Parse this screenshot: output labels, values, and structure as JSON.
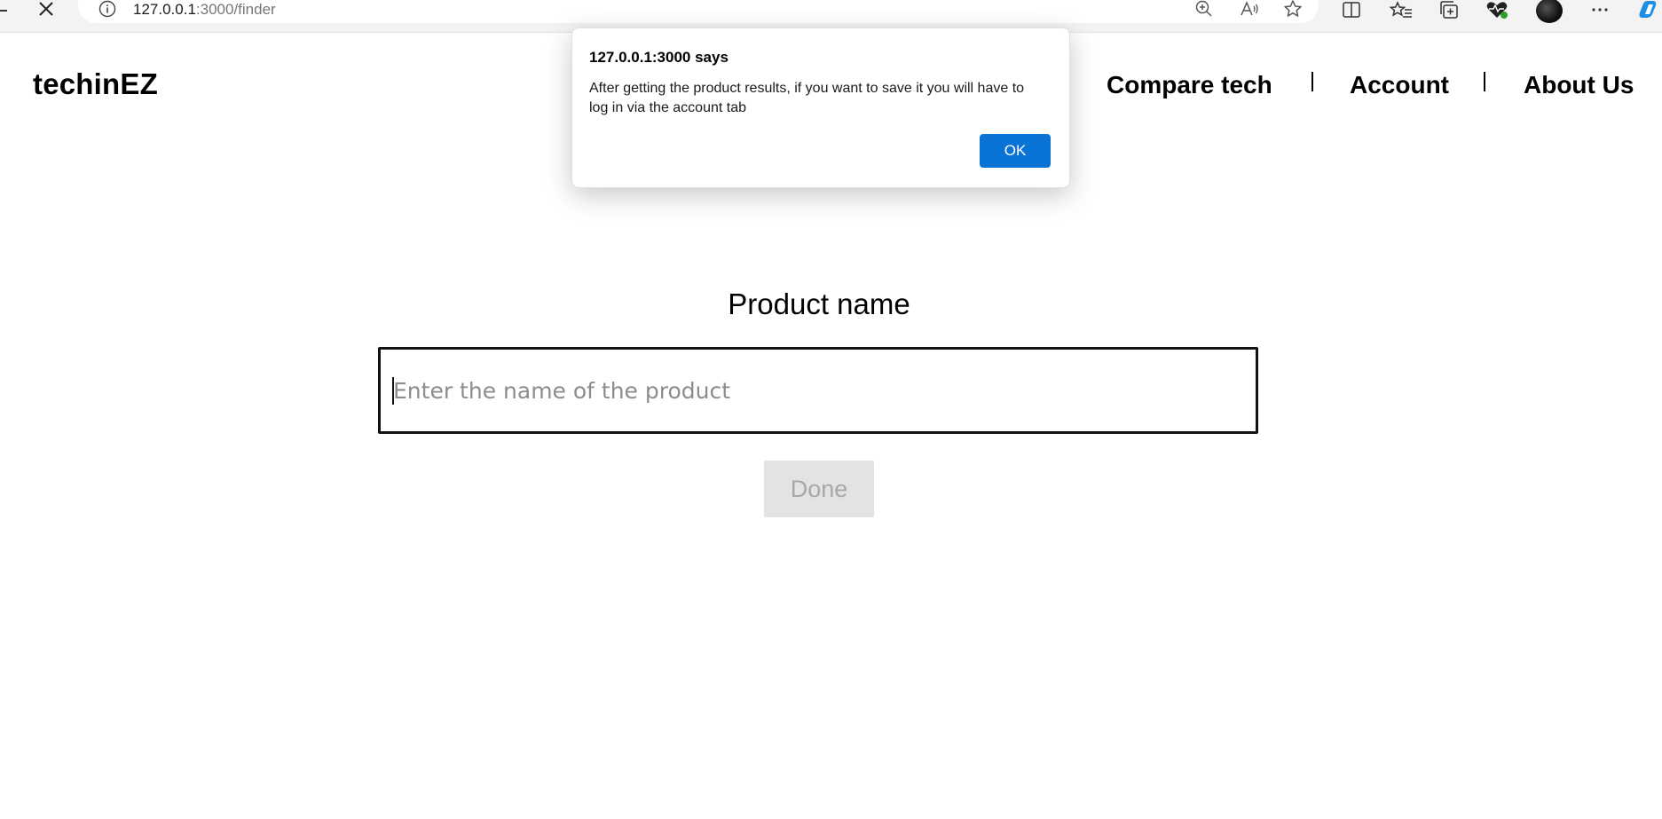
{
  "browser": {
    "url_host": "127.0.0.1",
    "url_path": ":3000/finder"
  },
  "site": {
    "logo": "techinEZ",
    "nav": {
      "compare": "Compare tech",
      "account": "Account",
      "about": "About Us"
    }
  },
  "form": {
    "label": "Product name",
    "placeholder": "Enter the name of the product",
    "done_label": "Done"
  },
  "dialog": {
    "title": "127.0.0.1:3000 says",
    "message": "After getting the product results, if you want to save it you will have to log in via the account tab",
    "ok_label": "OK"
  },
  "colors": {
    "ok_button": "#0a74d6",
    "done_button_bg": "#e3e3e3",
    "done_button_text": "#a8a8a8"
  }
}
